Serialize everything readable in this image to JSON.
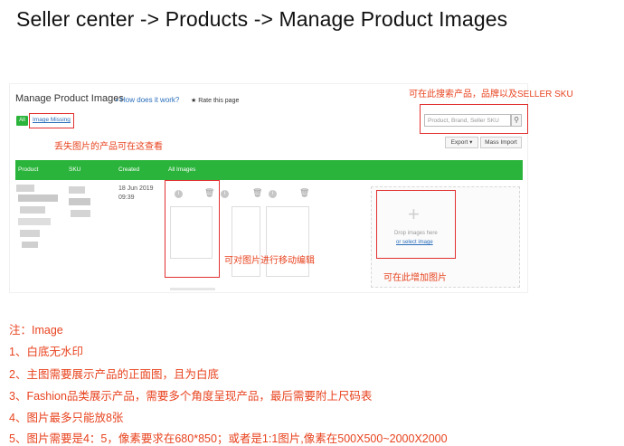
{
  "page": {
    "title": "Seller center -> Products -> Manage  Product Images"
  },
  "ui": {
    "title": "Manage Product Images",
    "how": "• How does it work?",
    "rate": "★ Rate this page",
    "tab_all": "All",
    "tab_missing": "Image Missing",
    "search_placeholder": "Product, Brand, Seller SKU",
    "export_label": "Export ▾",
    "mass_import_label": "Mass Import",
    "headers": [
      "Product",
      "SKU",
      "Created",
      "All Images"
    ],
    "row": {
      "date": "18 Jun 2019",
      "time": "09:39"
    },
    "drop_text": "Drop images here",
    "drop_link": "or select image"
  },
  "annotations": {
    "search_note": "可在此搜索产品，品牌以及SELLER SKU",
    "missing_note": "丢失图片的产品可在这查看",
    "edit_note": "可对图片进行移动编辑",
    "add_note": "可在此增加图片"
  },
  "notes": {
    "heading": "注：Image",
    "items": [
      "1、白底无水印",
      "2、主图需要展示产品的正面图，且为白底",
      "3、Fashion品类展示产品，需要多个角度呈现产品，最后需要附上尺码表",
      "4、图片最多只能放8张",
      "5、图片需要是4：5，像素要求在680*850；或者是1:1图片,像素在500X500~2000X2000"
    ]
  },
  "colors": {
    "accent_green": "#2bb43b",
    "annotation_red": "#e8431f",
    "link_blue": "#2a6ebb"
  }
}
